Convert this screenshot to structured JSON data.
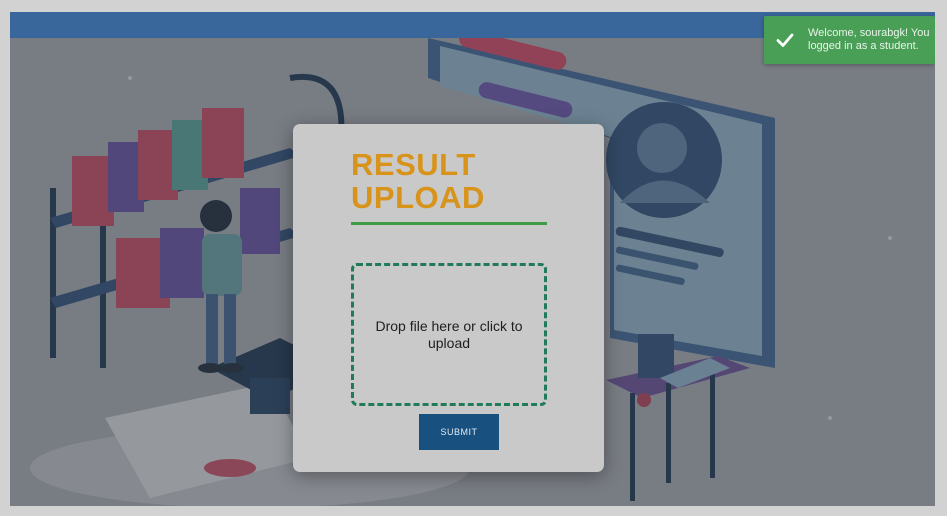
{
  "toast": {
    "icon": "checkmark-icon",
    "message_line1": "Welcome, sourabgk! You",
    "message_line2": "logged in as a student."
  },
  "modal": {
    "title_line1": "RESULT",
    "title_line2": "UPLOAD",
    "dropzone_text": "Drop file here or click to upload",
    "submit_label": "SUBMIT"
  },
  "colors": {
    "topbar": "#3a76bd",
    "title": "#d8931a",
    "rule": "#3d9c44",
    "dropzone_border": "#217a58",
    "submit": "#18507f",
    "toast": "#4a9f57"
  }
}
